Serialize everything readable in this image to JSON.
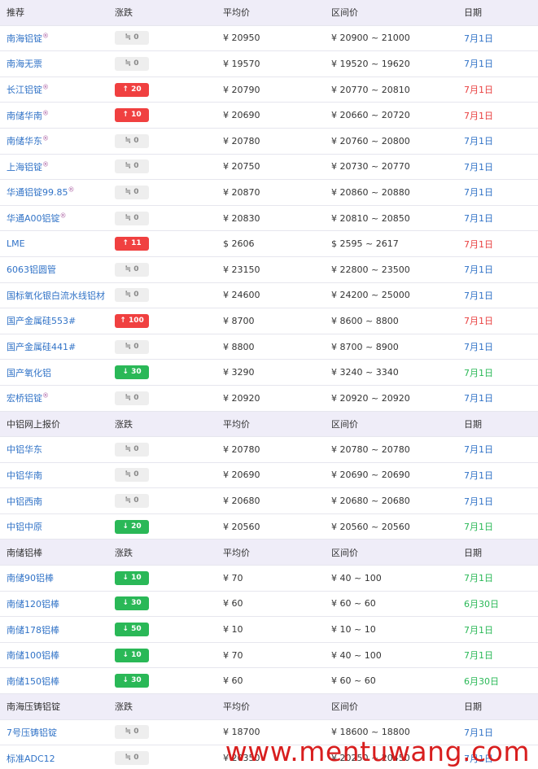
{
  "sections": [
    {
      "header": {
        "c1": "推荐",
        "c2": "涨跌",
        "c3": "平均价",
        "c4": "区间价",
        "c5": "日期"
      },
      "rows": [
        {
          "name": "南海铝锭",
          "mark": "®",
          "change": "0",
          "dir": "flat",
          "avg": "¥ 20950",
          "range": "¥ 20900 ~ 21000",
          "date": "7月1日",
          "date_color": "blue"
        },
        {
          "name": "南海无票",
          "mark": "",
          "change": "0",
          "dir": "flat",
          "avg": "¥ 19570",
          "range": "¥ 19520 ~ 19620",
          "date": "7月1日",
          "date_color": "blue"
        },
        {
          "name": "长江铝锭",
          "mark": "®",
          "change": "20",
          "dir": "up",
          "avg": "¥ 20790",
          "range": "¥ 20770 ~ 20810",
          "date": "7月1日",
          "date_color": "red"
        },
        {
          "name": "南储华南",
          "mark": "®",
          "change": "10",
          "dir": "up",
          "avg": "¥ 20690",
          "range": "¥ 20660 ~ 20720",
          "date": "7月1日",
          "date_color": "red"
        },
        {
          "name": "南储华东",
          "mark": "®",
          "change": "0",
          "dir": "flat",
          "avg": "¥ 20780",
          "range": "¥ 20760 ~ 20800",
          "date": "7月1日",
          "date_color": "blue"
        },
        {
          "name": "上海铝锭",
          "mark": "®",
          "change": "0",
          "dir": "flat",
          "avg": "¥ 20750",
          "range": "¥ 20730 ~ 20770",
          "date": "7月1日",
          "date_color": "blue"
        },
        {
          "name": "华通铝锭99.85",
          "mark": "®",
          "change": "0",
          "dir": "flat",
          "avg": "¥ 20870",
          "range": "¥ 20860 ~ 20880",
          "date": "7月1日",
          "date_color": "blue"
        },
        {
          "name": "华通A00铝锭",
          "mark": "®",
          "change": "0",
          "dir": "flat",
          "avg": "¥ 20830",
          "range": "¥ 20810 ~ 20850",
          "date": "7月1日",
          "date_color": "blue"
        },
        {
          "name": "LME",
          "mark": "",
          "change": "11",
          "dir": "up",
          "avg": "$ 2606",
          "range": "$ 2595 ~ 2617",
          "date": "7月1日",
          "date_color": "red"
        },
        {
          "name": "6063铝圆管",
          "mark": "",
          "change": "0",
          "dir": "flat",
          "avg": "¥ 23150",
          "range": "¥ 22800 ~ 23500",
          "date": "7月1日",
          "date_color": "blue"
        },
        {
          "name": "国标氧化银白流水线铝材",
          "mark": "",
          "change": "0",
          "dir": "flat",
          "avg": "¥ 24600",
          "range": "¥ 24200 ~ 25000",
          "date": "7月1日",
          "date_color": "blue"
        },
        {
          "name": "国产金属硅553#",
          "mark": "",
          "change": "100",
          "dir": "up",
          "avg": "¥ 8700",
          "range": "¥ 8600 ~ 8800",
          "date": "7月1日",
          "date_color": "red"
        },
        {
          "name": "国产金属硅441#",
          "mark": "",
          "change": "0",
          "dir": "flat",
          "avg": "¥ 8800",
          "range": "¥ 8700 ~ 8900",
          "date": "7月1日",
          "date_color": "blue"
        },
        {
          "name": "国产氧化铝",
          "mark": "",
          "change": "30",
          "dir": "down",
          "avg": "¥ 3290",
          "range": "¥ 3240 ~ 3340",
          "date": "7月1日",
          "date_color": "green"
        },
        {
          "name": "宏桥铝锭",
          "mark": "®",
          "change": "0",
          "dir": "flat",
          "avg": "¥ 20920",
          "range": "¥ 20920 ~ 20920",
          "date": "7月1日",
          "date_color": "blue"
        }
      ]
    },
    {
      "header": {
        "c1": "中铝网上报价",
        "c2": "涨跌",
        "c3": "平均价",
        "c4": "区间价",
        "c5": "日期"
      },
      "rows": [
        {
          "name": "中铝华东",
          "mark": "",
          "change": "0",
          "dir": "flat",
          "avg": "¥ 20780",
          "range": "¥ 20780 ~ 20780",
          "date": "7月1日",
          "date_color": "blue"
        },
        {
          "name": "中铝华南",
          "mark": "",
          "change": "0",
          "dir": "flat",
          "avg": "¥ 20690",
          "range": "¥ 20690 ~ 20690",
          "date": "7月1日",
          "date_color": "blue"
        },
        {
          "name": "中铝西南",
          "mark": "",
          "change": "0",
          "dir": "flat",
          "avg": "¥ 20680",
          "range": "¥ 20680 ~ 20680",
          "date": "7月1日",
          "date_color": "blue"
        },
        {
          "name": "中铝中原",
          "mark": "",
          "change": "20",
          "dir": "down",
          "avg": "¥ 20560",
          "range": "¥ 20560 ~ 20560",
          "date": "7月1日",
          "date_color": "green"
        }
      ]
    },
    {
      "header": {
        "c1": "南储铝棒",
        "c2": "涨跌",
        "c3": "平均价",
        "c4": "区间价",
        "c5": "日期"
      },
      "rows": [
        {
          "name": "南储90铝棒",
          "mark": "",
          "change": "10",
          "dir": "down",
          "avg": "¥ 70",
          "range": "¥ 40 ~ 100",
          "date": "7月1日",
          "date_color": "green"
        },
        {
          "name": "南储120铝棒",
          "mark": "",
          "change": "30",
          "dir": "down",
          "avg": "¥ 60",
          "range": "¥ 60 ~ 60",
          "date": "6月30日",
          "date_color": "green"
        },
        {
          "name": "南储178铝棒",
          "mark": "",
          "change": "50",
          "dir": "down",
          "avg": "¥ 10",
          "range": "¥ 10 ~ 10",
          "date": "7月1日",
          "date_color": "green"
        },
        {
          "name": "南储100铝棒",
          "mark": "",
          "change": "10",
          "dir": "down",
          "avg": "¥ 70",
          "range": "¥ 40 ~ 100",
          "date": "7月1日",
          "date_color": "green"
        },
        {
          "name": "南储150铝棒",
          "mark": "",
          "change": "30",
          "dir": "down",
          "avg": "¥ 60",
          "range": "¥ 60 ~ 60",
          "date": "6月30日",
          "date_color": "green"
        }
      ]
    },
    {
      "header": {
        "c1": "南海压铸铝锭",
        "c2": "涨跌",
        "c3": "平均价",
        "c4": "区间价",
        "c5": "日期"
      },
      "rows": [
        {
          "name": "7号压铸铝锭",
          "mark": "",
          "change": "0",
          "dir": "flat",
          "avg": "¥ 18700",
          "range": "¥ 18600 ~ 18800",
          "date": "7月1日",
          "date_color": "blue"
        },
        {
          "name": "标准ADC12",
          "mark": "",
          "change": "0",
          "dir": "flat",
          "avg": "¥ 20350",
          "range": "¥ 20250 ~ 20450",
          "date": "7月1日",
          "date_color": "blue"
        }
      ]
    }
  ],
  "icons": {
    "up": "↑",
    "down": "↓",
    "flat": "≒"
  },
  "colors": {
    "up": "#f04040",
    "down": "#2ab857",
    "link": "#3173c7",
    "header_bg": "#efedf8"
  },
  "watermark": "www.mentuwang.com"
}
